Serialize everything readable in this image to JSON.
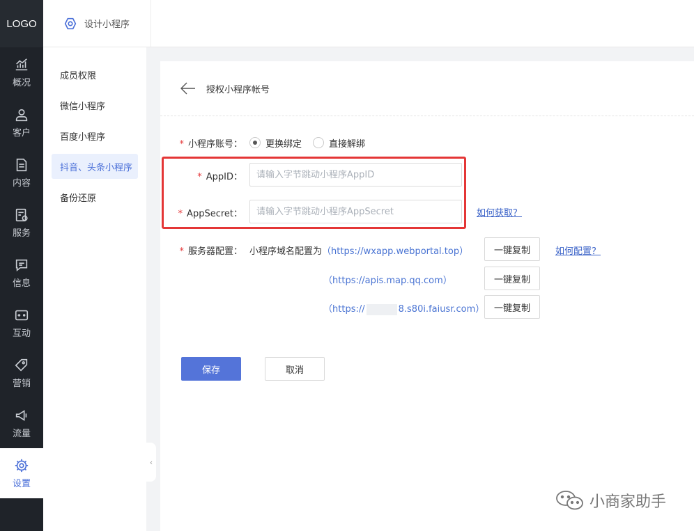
{
  "logo": "LOGO",
  "rail": [
    {
      "label": "概况",
      "icon": "chart-icon"
    },
    {
      "label": "客户",
      "icon": "user-icon"
    },
    {
      "label": "内容",
      "icon": "document-icon"
    },
    {
      "label": "服务",
      "icon": "service-icon"
    },
    {
      "label": "信息",
      "icon": "message-icon"
    },
    {
      "label": "互动",
      "icon": "gamepad-icon"
    },
    {
      "label": "营销",
      "icon": "tag-icon"
    },
    {
      "label": "流量",
      "icon": "megaphone-icon"
    },
    {
      "label": "设置",
      "icon": "gear-icon",
      "active": true
    }
  ],
  "topbar": {
    "title": "设计小程序"
  },
  "sidebar": {
    "items": [
      {
        "label": "成员权限"
      },
      {
        "label": "微信小程序"
      },
      {
        "label": "百度小程序"
      },
      {
        "label": "抖音、头条小程序",
        "active": true
      },
      {
        "label": "备份还原"
      }
    ]
  },
  "collapse": "‹",
  "panel": {
    "title": "授权小程序帐号",
    "account": {
      "label": "小程序账号：",
      "options": [
        {
          "label": "更换绑定",
          "checked": true
        },
        {
          "label": "直接解绑",
          "checked": false
        }
      ]
    },
    "appid": {
      "label": "AppID：",
      "placeholder": "请输入字节跳动小程序AppID",
      "value": ""
    },
    "appsecret": {
      "label": "AppSecret：",
      "placeholder": "请输入字节跳动小程序AppSecret",
      "value": "",
      "help": "如何获取？"
    },
    "server": {
      "label": "服务器配置：",
      "prefix": "小程序域名配置为",
      "help": "如何配置？",
      "domains": [
        {
          "open": "（",
          "url": "https://wxapp.webportal.top",
          "close": "）",
          "copy": "一键复制"
        },
        {
          "open": "（",
          "url": "https://apis.map.qq.com",
          "close": "）",
          "copy": "一键复制"
        },
        {
          "open": "（",
          "url_start": "https://",
          "url_end": "8.s80i.faiusr.com",
          "close": "）",
          "copy": "一键复制"
        }
      ]
    },
    "save": "保存",
    "cancel": "取消",
    "required_mark": "*"
  },
  "watermark": "小商家助手",
  "colors": {
    "accent": "#4a6fd8",
    "rail_bg": "#1f2329",
    "required": "#e5393b",
    "highlight_box": "#e43636"
  }
}
